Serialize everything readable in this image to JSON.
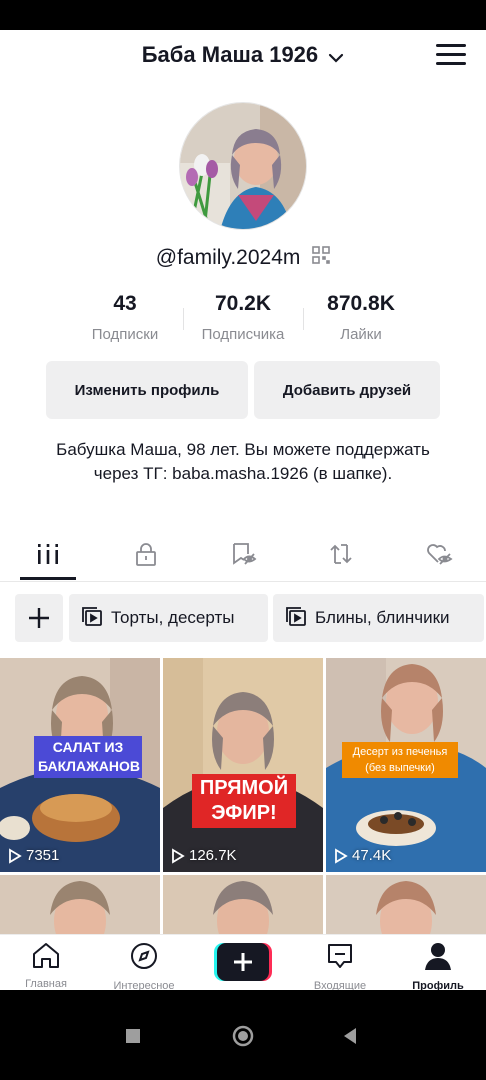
{
  "header": {
    "account_name": "Баба Маша 1926",
    "icons": {
      "account_dropdown": "chevron-down-icon",
      "menu": "hamburger-menu-icon"
    }
  },
  "profile": {
    "handle": "@family.2024m",
    "stats": [
      {
        "value": "43",
        "label": "Подписки"
      },
      {
        "value": "70.2K",
        "label": "Подписчика"
      },
      {
        "value": "870.8K",
        "label": "Лайки"
      }
    ],
    "edit_profile_label": "Изменить профиль",
    "add_friends_label": "Добавить друзей",
    "bio": "Бабушка Маша, 98 лет. Вы можете поддержать через ТГ: baba.masha.1926 (в шапке)."
  },
  "tabs": [
    {
      "icon": "videos-grid-icon",
      "active": true
    },
    {
      "icon": "private-lock-icon",
      "active": false
    },
    {
      "icon": "favorites-hidden-icon",
      "active": false
    },
    {
      "icon": "reposts-icon",
      "active": false
    },
    {
      "icon": "liked-hidden-icon",
      "active": false
    }
  ],
  "playlists": [
    {
      "label": "Торты, десерты"
    },
    {
      "label": "Блины, блинчики"
    }
  ],
  "videos": [
    {
      "caption": "САЛАТ ИЗ БАКЛАЖАНОВ",
      "views": "7351"
    },
    {
      "caption": "ПРЯМОЙ ЭФИР!",
      "views": "126.7K"
    },
    {
      "caption": "Десерт из печенья (без выпечки)",
      "views": "47.4K"
    },
    {
      "caption": "",
      "views": ""
    },
    {
      "caption": "",
      "views": ""
    },
    {
      "caption": "",
      "views": ""
    }
  ],
  "bottom_nav": [
    {
      "label": "Главная",
      "icon": "home-icon"
    },
    {
      "label": "Интересное",
      "icon": "compass-icon"
    },
    {
      "label": "",
      "icon": "create-plus-icon"
    },
    {
      "label": "Входящие",
      "icon": "inbox-icon"
    },
    {
      "label": "Профиль",
      "icon": "profile-icon",
      "active": true
    }
  ],
  "colors": {
    "text": "#161823",
    "secondary_text": "#8a8b91",
    "button_bg": "#efeff0",
    "caption_blue": "#4b4ad6",
    "caption_red": "#e02626",
    "caption_orange": "#f08a00",
    "create_cyan": "#25f4ee",
    "create_red": "#fe2c55"
  }
}
